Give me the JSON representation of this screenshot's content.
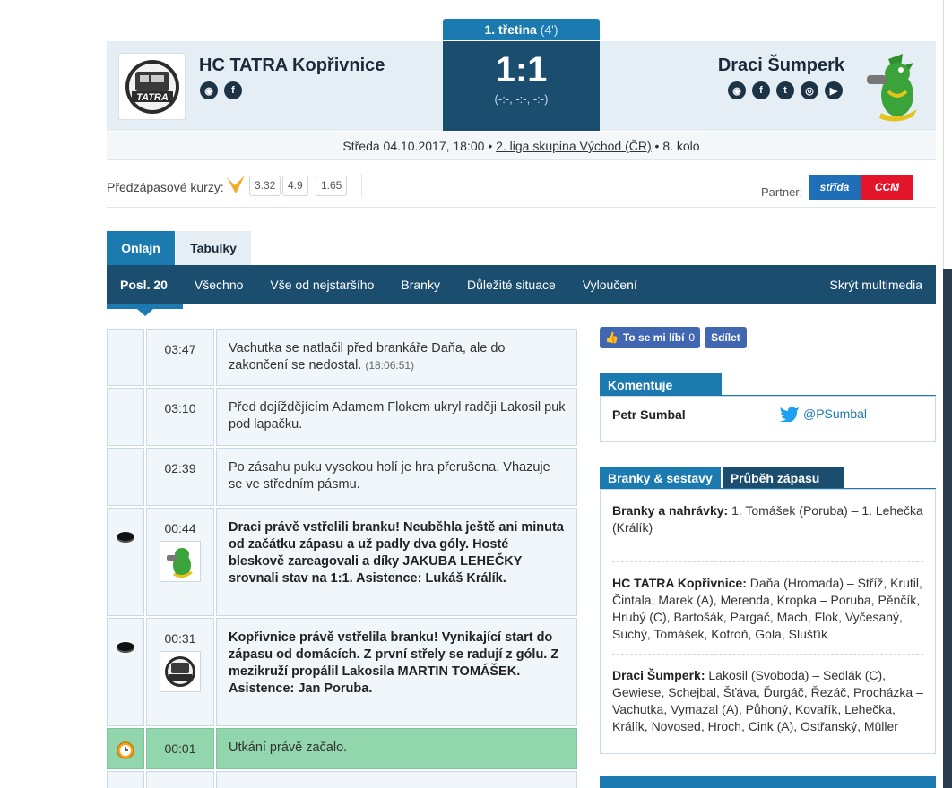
{
  "period_tab": {
    "label": "1. třetina",
    "minute": "(4')"
  },
  "home": {
    "name": "HC TATRA Kopřivnice",
    "logo_text": "TATRA"
  },
  "away": {
    "name": "Draci Šumperk"
  },
  "score": {
    "main": "1:1",
    "periods": "(-:-, -:-, -:-)"
  },
  "info": {
    "date": "Středa 04.10.2017, 18:00 •",
    "league": "2. liga skupina Východ (ČR)",
    "round": "• 8. kolo"
  },
  "odds": {
    "label": "Předzápasové kurzy:",
    "values": [
      "3.32",
      "4.9",
      "1.65"
    ]
  },
  "partner": {
    "label": "Partner:",
    "logo_left": "střída",
    "logo_right": "CCM"
  },
  "tabs": [
    "Onlajn",
    "Tabulky"
  ],
  "subnav": {
    "items": [
      "Posl. 20",
      "Všechno",
      "Vše od nejstaršího",
      "Branky",
      "Důležité situace",
      "Vyloučení"
    ],
    "right": "Skrýt multimedia"
  },
  "feed": [
    {
      "time": "03:47",
      "text": "Vachutka se natlačil před brankáře Daňa, ale do zakončení se nedostal.",
      "stamp": "(18:06:51)"
    },
    {
      "time": "03:10",
      "text": "Před dojíždějícím Adamem Flokem ukryl raději Lakosil puk pod lapačku."
    },
    {
      "time": "02:39",
      "text": "Po zásahu puku vysokou holí je hra přerušena. Vhazuje se ve středním pásmu."
    },
    {
      "time": "00:44",
      "text": "Draci právě vstřelili branku! Neuběhla ještě ani minuta od začátku zápasu a už padly dva góly. Hosté bleskově zareagovali a díky JAKUBA LEHEČKY srovnali stav na 1:1. Asistence: Lukáš Králík."
    },
    {
      "time": "00:31",
      "text": "Kopřivnice právě vstřelila branku! Vynikající start do zápasu od domácích. Z první střely se radují z gólu. Z mezikruží propálil Lakosila MARTIN TOMÁŠEK. Asistence: Jan Poruba."
    },
    {
      "time": "00:01",
      "text": "Utkání právě začalo."
    }
  ],
  "facebook": {
    "like": "To se mi líbí",
    "count": "0",
    "share": "Sdílet"
  },
  "commentary": {
    "tab": "Komentuje",
    "name": "Petr Sumbal",
    "twitter": "@PSumbal"
  },
  "lineups": {
    "tabs": [
      "Branky & sestavy",
      "Průběh zápasu"
    ],
    "goals_label": "Branky a nahrávky:",
    "goals": "1. Tomášek (Poruba) – 1. Lehečka (Králík)",
    "home_label": "HC TATRA Kopřivnice:",
    "home": "Daňa (Hromada) – Stříž, Krutil, Čintala, Marek (A), Merenda, Kropka – Poruba, Pěnčík, Hrubý (C), Bartošák, Pargač, Mach, Flok, Vyčesaný, Suchý, Tomášek, Kofroň, Gola, Slušťík",
    "away_label": "Draci Šumperk:",
    "away": "Lakosil (Svoboda) – Sedlák (C), Gewiese, Schejbal, Šťáva, Ďurgáč, Řezáč, Procházka – Vachutka, Vymazal (A), Půhoný, Kovařík, Lehečka, Králík, Novosed, Hroch, Cink (A), Ostřanský, Müller"
  },
  "colors": {
    "accent": "#1b7ab0",
    "dark": "#1b4d6f",
    "goal_green": "#92d6ad"
  }
}
